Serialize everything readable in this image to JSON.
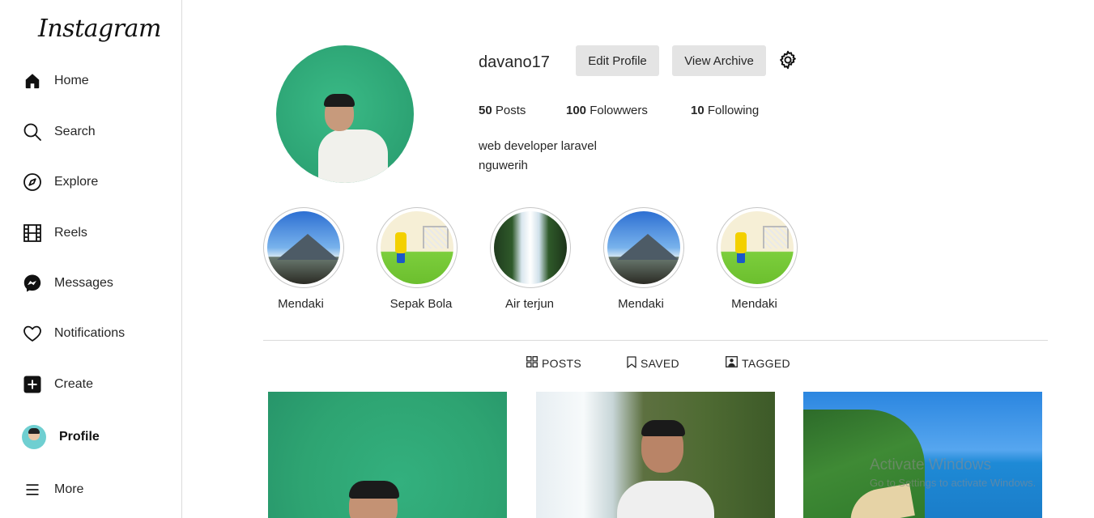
{
  "sidebar": {
    "logo": "Instagram",
    "items": [
      {
        "label": "Home",
        "icon": "home-icon"
      },
      {
        "label": "Search",
        "icon": "search-icon"
      },
      {
        "label": "Explore",
        "icon": "compass-icon"
      },
      {
        "label": "Reels",
        "icon": "film-icon"
      },
      {
        "label": "Messages",
        "icon": "messenger-icon"
      },
      {
        "label": "Notifications",
        "icon": "heart-icon"
      },
      {
        "label": "Create",
        "icon": "plus-square-icon"
      },
      {
        "label": "Profile",
        "icon": "avatar"
      },
      {
        "label": "More",
        "icon": "menu-icon"
      }
    ]
  },
  "profile": {
    "username": "davano17",
    "edit_label": "Edit Profile",
    "archive_label": "View Archive",
    "stats": {
      "posts_count": "50",
      "posts_label": "Posts",
      "followers_count": "100",
      "followers_label": "Folowwers",
      "following_count": "10",
      "following_label": "Following"
    },
    "bio": [
      "web developer laravel",
      "nguwerih"
    ]
  },
  "highlights": [
    {
      "label": "Mendaki",
      "image": "mountain"
    },
    {
      "label": "Sepak Bola",
      "image": "soccer"
    },
    {
      "label": "Air terjun",
      "image": "waterfall"
    },
    {
      "label": "Mendaki",
      "image": "mountain"
    },
    {
      "label": "Mendaki",
      "image": "soccer"
    }
  ],
  "tabs": [
    {
      "label": "POSTS",
      "icon": "grid-icon"
    },
    {
      "label": "SAVED",
      "icon": "bookmark-icon"
    },
    {
      "label": "TAGGED",
      "icon": "tag-person-icon"
    }
  ],
  "watermark": {
    "line1": "Activate Windows",
    "line2": "Go to Settings to activate Windows."
  },
  "colors": {
    "sidebar_border": "#dbdbdb",
    "button_bg": "#e4e4e4",
    "text": "#262626",
    "profile_bg": "#2ea676"
  }
}
